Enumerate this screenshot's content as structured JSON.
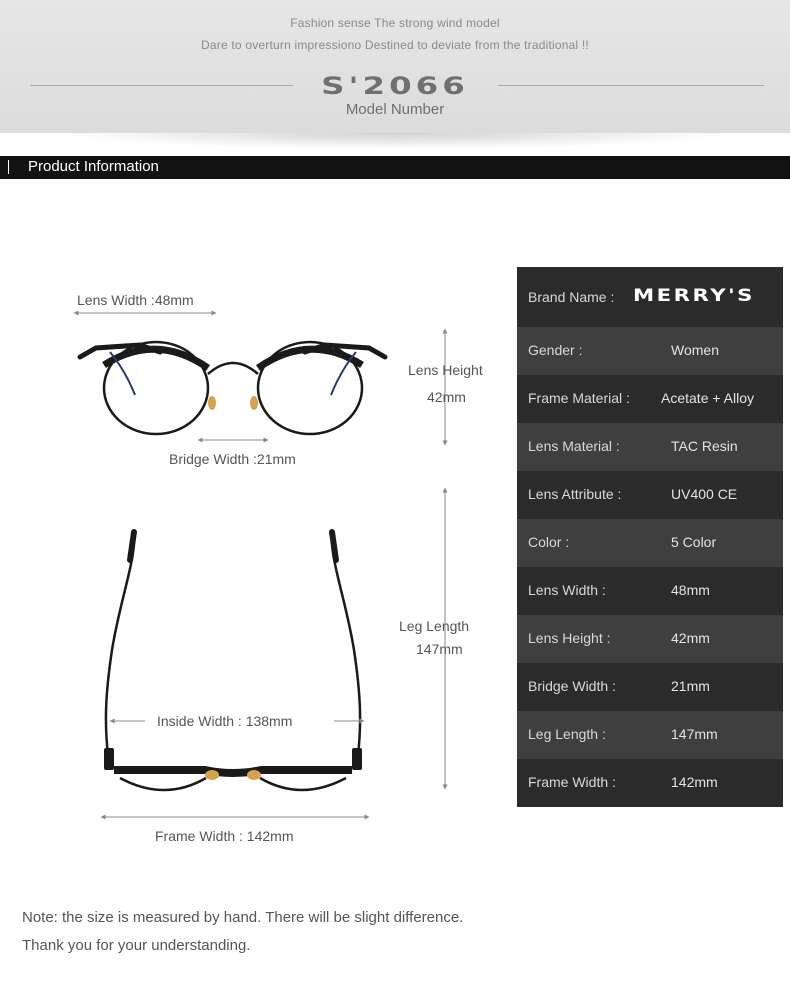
{
  "banner": {
    "tagline_1": "Fashion sense The strong wind model",
    "tagline_2": "Dare to overturn impressiono Destined to deviate from the traditional !!",
    "model_number": "S'2066",
    "model_label": "Model Number"
  },
  "section": {
    "title": "Product Information"
  },
  "dimensions": {
    "lens_width": "Lens Width :48mm",
    "lens_height_label": "Lens Height",
    "lens_height_value": "42mm",
    "bridge_width": "Bridge Width :21mm",
    "leg_length_label": "Leg Length",
    "leg_length_value": "147mm",
    "inside_width": "Inside  Width : 138mm",
    "frame_width": "Frame Width : 142mm"
  },
  "specs": [
    {
      "label": "Brand Name :",
      "value": "MERRY'S"
    },
    {
      "label": "Gender :",
      "value": "Women"
    },
    {
      "label": "Frame Material :",
      "value": "Acetate + Alloy"
    },
    {
      "label": "Lens Material :",
      "value": "TAC Resin"
    },
    {
      "label": "Lens Attribute :",
      "value": "UV400 CE"
    },
    {
      "label": "Color :",
      "value": "5 Color"
    },
    {
      "label": "Lens Width :",
      "value": "48mm"
    },
    {
      "label": "Lens Height :",
      "value": "42mm"
    },
    {
      "label": "Bridge Width :",
      "value": "21mm"
    },
    {
      "label": "Leg Length :",
      "value": "147mm"
    },
    {
      "label": "Frame Width :",
      "value": "142mm"
    }
  ],
  "note": {
    "line_1": "Note: the size is measured by hand. There will be slight difference.",
    "line_2": "Thank you for your understanding."
  },
  "colors": {
    "table_dark": "#2b2b2b",
    "table_light": "#3f3f3f",
    "header_bar": "#121212",
    "banner_bg": "#e0e0e0"
  }
}
